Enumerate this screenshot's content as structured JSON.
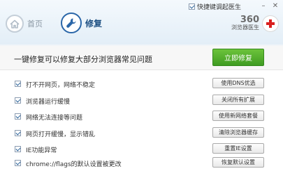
{
  "header": {
    "toggle_label": "快捷键调起医生",
    "toggle_checked": true,
    "nav": [
      {
        "label": "首页",
        "icon": "home-icon",
        "active": false
      },
      {
        "label": "修复",
        "icon": "wrench-icon",
        "active": true
      }
    ],
    "brand_number": "360",
    "brand_sub": "浏览器医生",
    "window_controls": [
      "minimize-icon",
      "close-icon"
    ]
  },
  "main": {
    "headline": "一键修复可以修复大部分浏览器常见问题",
    "fix_button": "立即修复"
  },
  "issues": [
    {
      "label": "打不开网页，网络不稳定",
      "action": "使用DNS优选",
      "checked": true
    },
    {
      "label": "浏览器运行缓慢",
      "action": "关闭所有扩展",
      "checked": true
    },
    {
      "label": "网络无法连接等问题",
      "action": "使用新网络套餐",
      "checked": true
    },
    {
      "label": "网页打开缓慢，显示错乱",
      "action": "清除浏览器缓存",
      "checked": true
    },
    {
      "label": "IE功能异常",
      "action": "重置IE设置",
      "checked": true
    },
    {
      "label": "chrome://flags的默认设置被更改",
      "action": "恢复默认设置",
      "checked": true
    }
  ],
  "colors": {
    "accent": "#2a66a8",
    "fix_button": "#4fae2b",
    "brand_red": "#d9201f"
  }
}
